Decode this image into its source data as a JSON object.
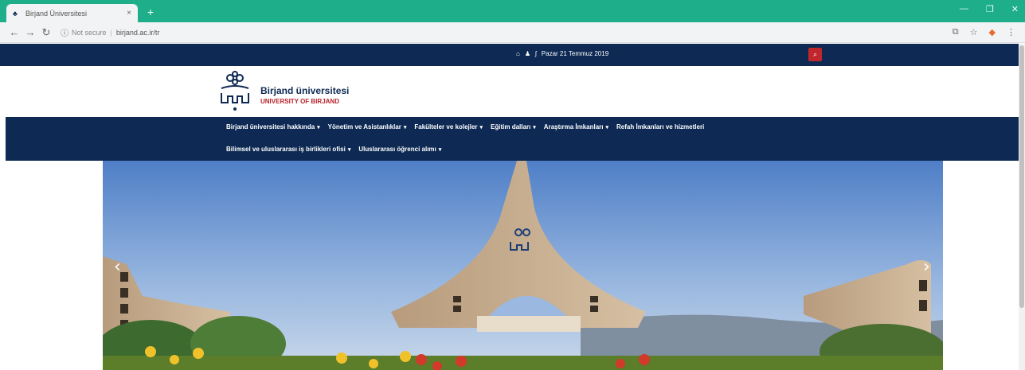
{
  "browser": {
    "tab_title": "Birjand Üniversitesi",
    "tab_close": "×",
    "new_tab": "+",
    "security_label": "Not secure",
    "url": "birjand.ac.ir/tr"
  },
  "topbar": {
    "date": "Pazar 21 Temmuz 2019"
  },
  "header": {
    "name": "Birjand üniversitesi",
    "subtitle": "UNIVERSITY OF BIRJAND"
  },
  "nav": {
    "row1": [
      "Birjand üniversitesi hakkında",
      "Yönetim ve Asistanlıklar",
      "Fakülteler ve kolejler",
      "Eğitim dalları",
      "Araştırma İmkanları",
      "Refah İmkanları ve hizmetleri"
    ],
    "row2": [
      "Bilimsel ve uluslararası iş birlikleri ofisi",
      "Uluslararası öğrenci alımı"
    ]
  },
  "colors": {
    "chrome_accent": "#1fae8a",
    "navy": "#0e2a54",
    "red": "#c0272d"
  }
}
